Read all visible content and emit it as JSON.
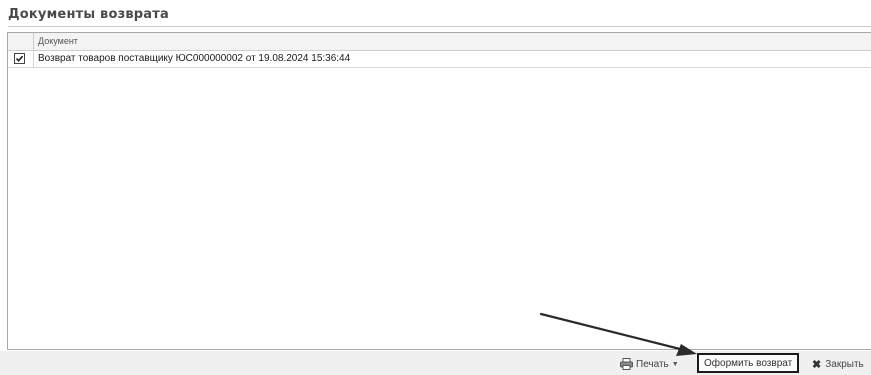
{
  "section": {
    "title": "Документы возврата"
  },
  "table": {
    "columns": [
      "Документ"
    ],
    "rows": [
      {
        "checked": true,
        "document": "Возврат товаров поставщику ЮС000000002 от 19.08.2024 15:36:44"
      }
    ]
  },
  "footer": {
    "print_label": "Печать",
    "print_icon": "printer-icon",
    "create_return_label": "Оформить возврат",
    "close_label": "Закрыть",
    "close_icon": "close-icon"
  },
  "colors": {
    "title": "#4a4a4a",
    "border": "#a9a9a9",
    "footer_bg": "#f0f0f0",
    "highlight_border": "#1a1a1a"
  }
}
